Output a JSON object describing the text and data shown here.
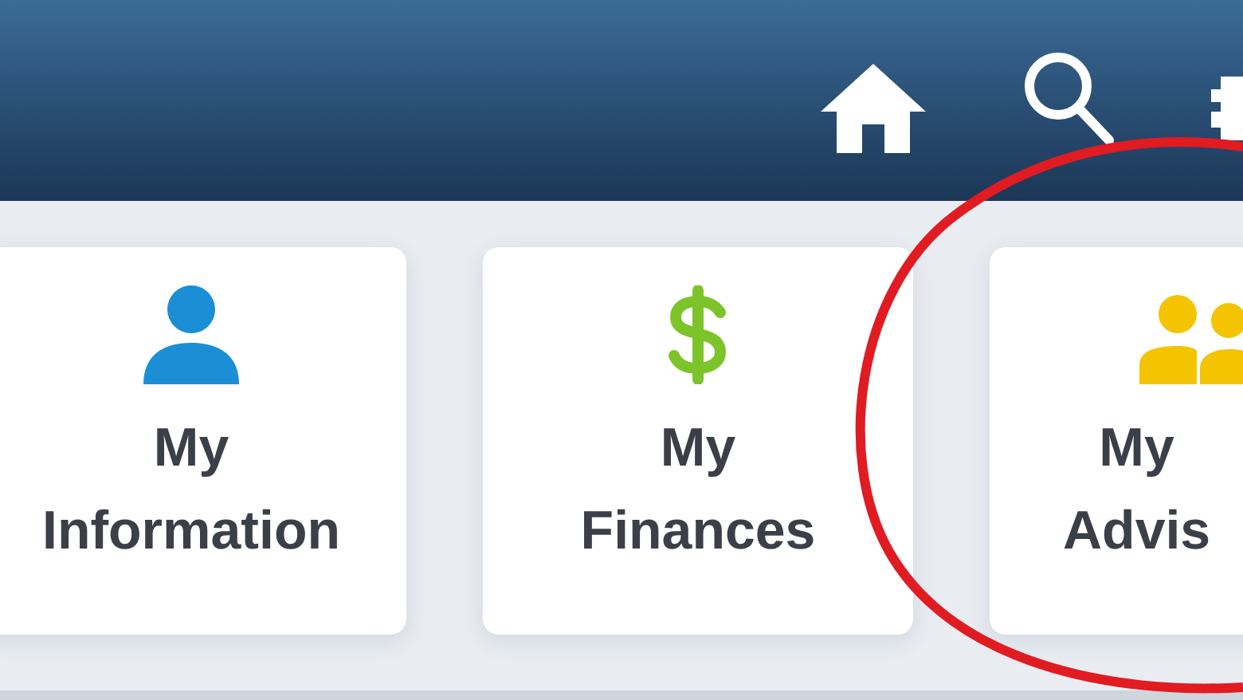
{
  "cards": [
    {
      "lines": [
        "My",
        "Information"
      ],
      "color": "#1a8fd6"
    },
    {
      "lines": [
        "My",
        "Finances"
      ],
      "color": "#7cc42a"
    },
    {
      "lines": [
        "My",
        "Advis"
      ],
      "color": "#f5c400"
    }
  ]
}
